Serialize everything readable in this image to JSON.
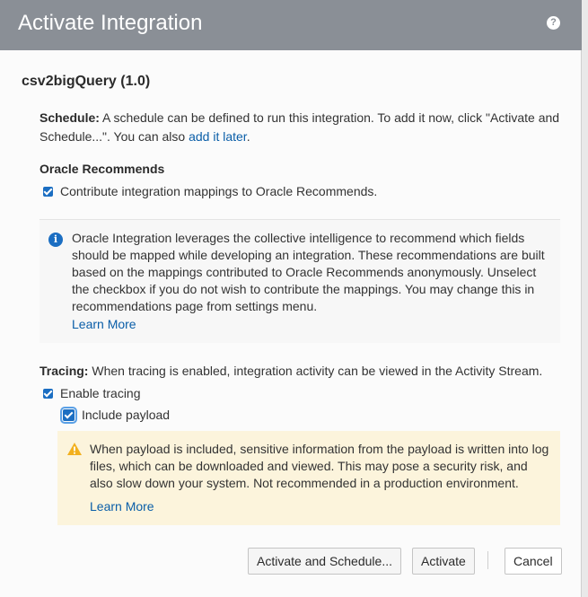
{
  "dialog": {
    "title": "Activate Integration",
    "help_icon": "question-circle-icon",
    "integration_name": "csv2bigQuery (1.0)"
  },
  "schedule": {
    "label": "Schedule:",
    "text": " A schedule can be defined to run this integration. To add it now, click \"Activate and Schedule...\". You can also ",
    "link": "add it later",
    "suffix": "."
  },
  "recommends": {
    "title": "Oracle Recommends",
    "checkbox_label": "Contribute integration mappings to Oracle Recommends.",
    "checked": true,
    "info_icon": "info-circle-icon",
    "info_text": "Oracle Integration leverages the collective intelligence to recommend which fields should be mapped while developing an integration. These recommendations are built based on the mappings contributed to Oracle Recommends anonymously. Unselect the checkbox if you do not wish to contribute the mappings. You may change this in recommendations page from settings menu.",
    "learn_more": "Learn More"
  },
  "tracing": {
    "label": "Tracing:",
    "text": " When tracing is enabled, integration activity can be viewed in the Activity Stream.",
    "enable_label": "Enable tracing",
    "enable_checked": true,
    "payload_label": "Include payload",
    "payload_checked": true,
    "warning_icon": "warning-triangle-icon",
    "warning_text": "When payload is included, sensitive information from the payload is written into log files, which can be downloaded and viewed. This may pose a security risk, and also slow down your system. Not recommended in a production environment.",
    "learn_more": "Learn More"
  },
  "buttons": {
    "activate_schedule": "Activate and Schedule...",
    "activate": "Activate",
    "cancel": "Cancel"
  },
  "colors": {
    "header_bg": "#8a8f96",
    "link": "#0a5ea8",
    "checkbox": "#1b6ec2",
    "warning_bg": "#fcf4dc",
    "warning_icon": "#f2b01e"
  }
}
